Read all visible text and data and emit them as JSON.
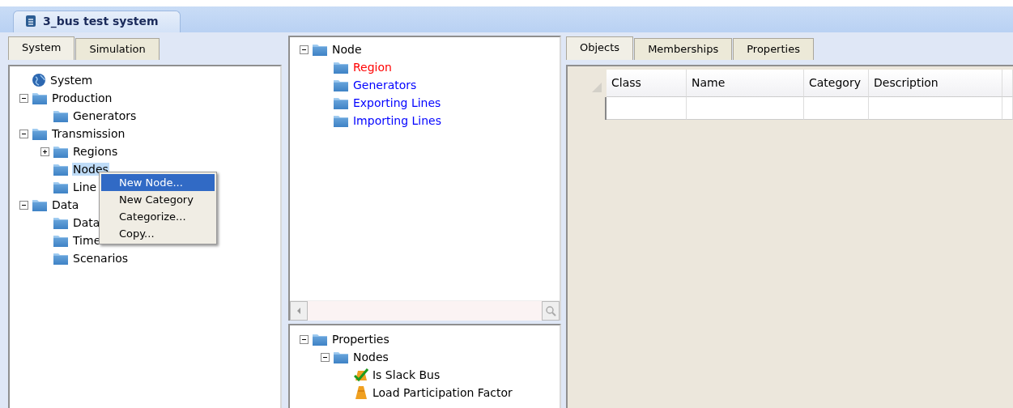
{
  "document_tab": {
    "title": "3_bus test system",
    "selected": true
  },
  "left_panel": {
    "tabs": [
      {
        "label": "System",
        "selected": true
      },
      {
        "label": "Simulation",
        "selected": false
      }
    ],
    "tree": [
      {
        "label": "System",
        "kind": "globe",
        "selected": false
      },
      {
        "label": "Production",
        "kind": "folder",
        "expanded": true,
        "selected": false,
        "children": [
          {
            "label": "Generators",
            "kind": "folder",
            "selected": false
          }
        ]
      },
      {
        "label": "Transmission",
        "kind": "folder",
        "expanded": true,
        "selected": false,
        "children": [
          {
            "label": "Regions",
            "kind": "folder",
            "expanded": false,
            "selected": false
          },
          {
            "label": "Nodes",
            "kind": "folder",
            "selected": true
          },
          {
            "label": "Line",
            "kind": "folder",
            "selected": false
          }
        ]
      },
      {
        "label": "Data",
        "kind": "folder",
        "expanded": true,
        "selected": false,
        "children": [
          {
            "label": "Data",
            "kind": "folder",
            "selected": false
          },
          {
            "label": "Time",
            "kind": "folder",
            "selected": false
          },
          {
            "label": "Scenarios",
            "kind": "folder",
            "selected": false
          }
        ]
      }
    ],
    "context_menu": [
      {
        "label": "New Node...",
        "selected": true
      },
      {
        "label": "New Category",
        "selected": false
      },
      {
        "label": "Categorize...",
        "selected": false
      },
      {
        "label": "Copy...",
        "selected": false
      }
    ]
  },
  "middle_panel": {
    "tree": [
      {
        "label": "Node",
        "kind": "folder",
        "expanded": true,
        "selected": false,
        "color": "#000000",
        "children": [
          {
            "label": "Region",
            "kind": "folder",
            "selected": false,
            "color": "#ff0000"
          },
          {
            "label": "Generators",
            "kind": "folder",
            "selected": false,
            "color": "#0000ff"
          },
          {
            "label": "Exporting Lines",
            "kind": "folder",
            "selected": false,
            "color": "#0000ff"
          },
          {
            "label": "Importing Lines",
            "kind": "folder",
            "selected": false,
            "color": "#0000ff"
          }
        ]
      }
    ],
    "properties_tree": [
      {
        "label": "Properties",
        "kind": "folder",
        "expanded": true,
        "selected": false,
        "color": "#000000",
        "children": [
          {
            "label": "Nodes",
            "kind": "folder",
            "expanded": true,
            "selected": false,
            "color": "#000000",
            "children": [
              {
                "label": "Is Slack Bus",
                "kind": "check",
                "selected": false,
                "color": "#000000"
              },
              {
                "label": "Load Participation Factor",
                "kind": "cone",
                "selected": false,
                "color": "#000000"
              }
            ]
          }
        ]
      }
    ]
  },
  "right_panel": {
    "tabs": [
      {
        "label": "Objects",
        "selected": true
      },
      {
        "label": "Memberships",
        "selected": false
      },
      {
        "label": "Properties",
        "selected": false
      }
    ],
    "table": {
      "columns": [
        "Class",
        "Name",
        "Category",
        "Description"
      ]
    }
  }
}
